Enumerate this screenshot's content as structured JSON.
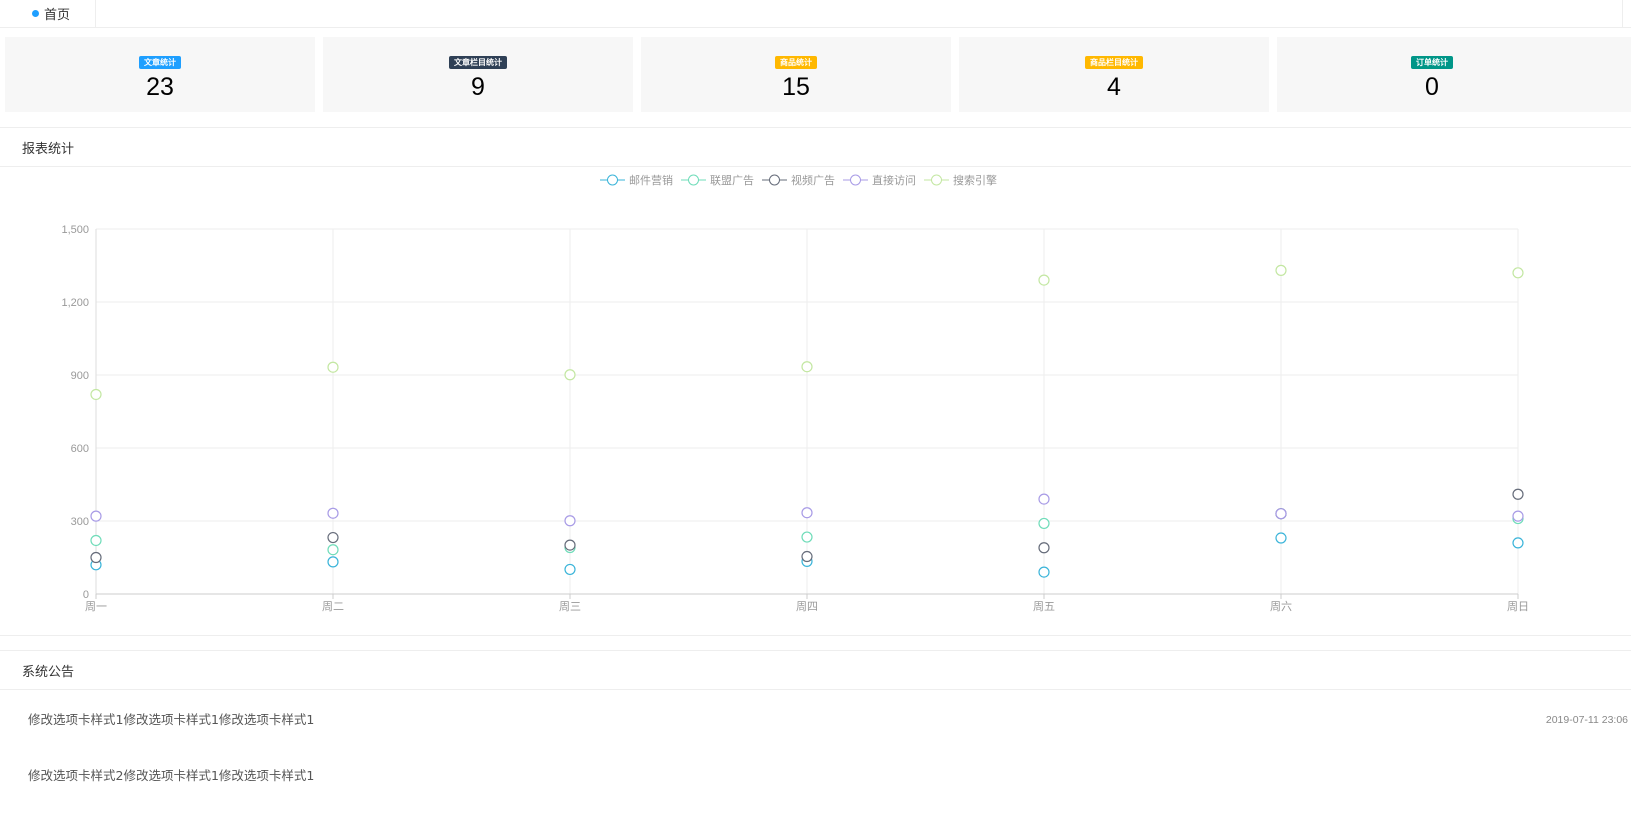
{
  "tabs": [
    {
      "label": "首页"
    }
  ],
  "cards": [
    {
      "badge": "文章统计",
      "value": "23",
      "color": "#1E9FFF"
    },
    {
      "badge": "文章栏目统计",
      "value": "9",
      "color": "#2F4056"
    },
    {
      "badge": "商品统计",
      "value": "15",
      "color": "#FFB800"
    },
    {
      "badge": "商品栏目统计",
      "value": "4",
      "color": "#FFB800"
    },
    {
      "badge": "订单统计",
      "value": "0",
      "color": "#009688"
    }
  ],
  "report": {
    "title": "报表统计"
  },
  "chart_data": {
    "type": "scatter",
    "categories": [
      "周一",
      "周二",
      "周三",
      "周四",
      "周五",
      "周六",
      "周日"
    ],
    "ylim": [
      0,
      1500
    ],
    "yticks": [
      "0",
      "300",
      "600",
      "900",
      "1,200",
      "1,500"
    ],
    "grid": true,
    "legend_position": "top-center",
    "series": [
      {
        "name": "邮件营销",
        "color": "#3ab4d9",
        "values": [
          120,
          132,
          101,
          134,
          90,
          230,
          210
        ]
      },
      {
        "name": "联盟广告",
        "color": "#6fdcb9",
        "values": [
          220,
          182,
          191,
          234,
          290,
          330,
          310
        ]
      },
      {
        "name": "视频广告",
        "color": "#666c7a",
        "values": [
          150,
          232,
          201,
          154,
          190,
          330,
          410
        ]
      },
      {
        "name": "直接访问",
        "color": "#a89be6",
        "values": [
          320,
          332,
          301,
          334,
          390,
          330,
          320
        ]
      },
      {
        "name": "搜索引擎",
        "color": "#c3e7a2",
        "values": [
          820,
          932,
          901,
          934,
          1290,
          1330,
          1320
        ]
      }
    ]
  },
  "notices": {
    "title": "系统公告",
    "items": [
      {
        "text": "修改选项卡样式1修改选项卡样式1修改选项卡样式1",
        "date": "2019-07-11 23:06"
      },
      {
        "text": "修改选项卡样式2修改选项卡样式1修改选项卡样式1",
        "date": ""
      }
    ]
  }
}
